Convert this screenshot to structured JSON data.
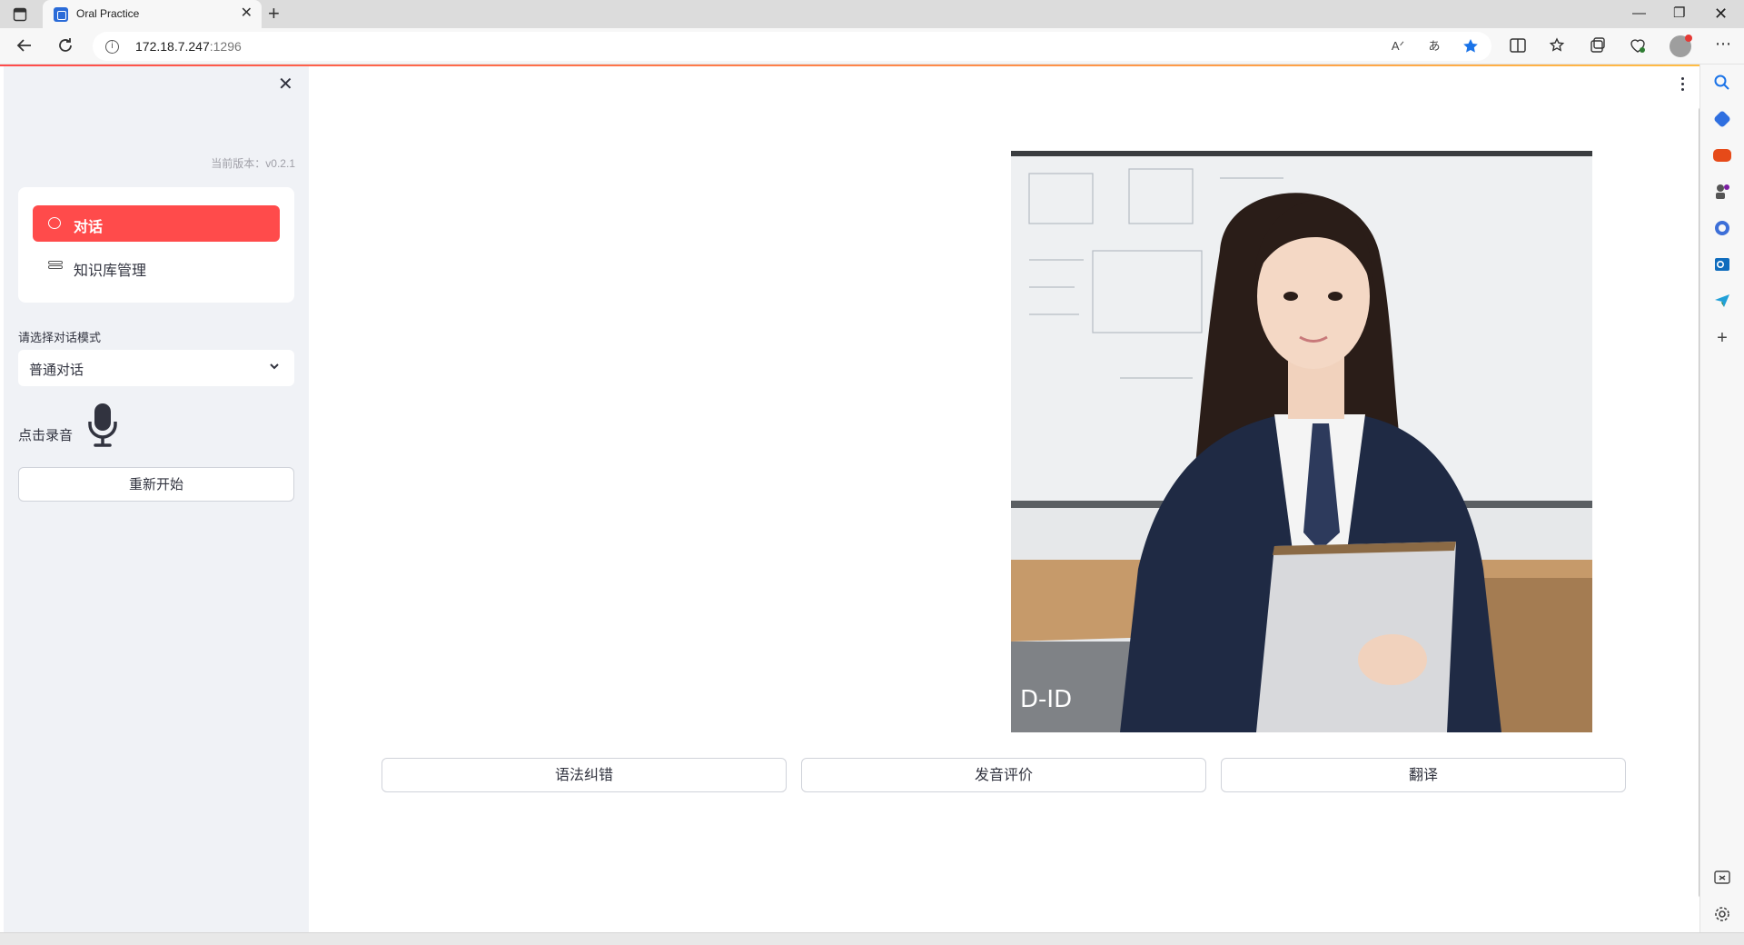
{
  "browser": {
    "tab_title": "Oral Practice",
    "url_host": "172.18.7.247",
    "url_port": ":1296"
  },
  "sidebar": {
    "version_text": "当前版本：v0.2.1",
    "menu": {
      "active_label": "对话",
      "second_label": "知识库管理"
    },
    "mode_select": {
      "label": "请选择对话模式",
      "value": "普通对话"
    },
    "record_label": "点击录音",
    "restart_label": "重新开始"
  },
  "main": {
    "avatar_watermark": "D-ID",
    "buttons": {
      "grammar": "语法纠错",
      "pronunciation": "发音评价",
      "translate": "翻译"
    }
  },
  "colors": {
    "accent": "#ff4b4b",
    "sidebar_bg": "#f0f2f6",
    "browser_accent": "#1a73e8"
  }
}
